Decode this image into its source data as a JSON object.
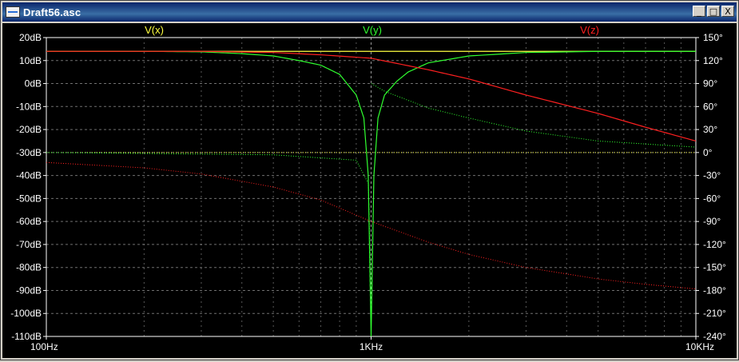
{
  "window": {
    "title": "Draft56.asc",
    "controls": {
      "minimize": "_",
      "maximize": "□",
      "close": "X"
    }
  },
  "colors": {
    "background": "#000000",
    "axis_text": "#ffffff",
    "grid": "#a0a0a0",
    "vx": "#ffff40",
    "vy": "#30ff30",
    "vz": "#ff2020"
  },
  "chart_data": {
    "type": "line",
    "x_scale": "log",
    "xlim": [
      100,
      10000
    ],
    "ylim_left_db": [
      -110,
      20
    ],
    "ylim_right_deg": [
      -240,
      150
    ],
    "grid": true,
    "x_ticks": [
      {
        "value": 100,
        "label": "100Hz"
      },
      {
        "value": 1000,
        "label": "1KHz"
      },
      {
        "value": 10000,
        "label": "10KHz"
      }
    ],
    "y_ticks_left": [
      {
        "value": 20,
        "label": "20dB"
      },
      {
        "value": 10,
        "label": "10dB"
      },
      {
        "value": 0,
        "label": "0dB"
      },
      {
        "value": -10,
        "label": "-10dB"
      },
      {
        "value": -20,
        "label": "-20dB"
      },
      {
        "value": -30,
        "label": "-30dB"
      },
      {
        "value": -40,
        "label": "-40dB"
      },
      {
        "value": -50,
        "label": "-50dB"
      },
      {
        "value": -60,
        "label": "-60dB"
      },
      {
        "value": -70,
        "label": "-70dB"
      },
      {
        "value": -80,
        "label": "-80dB"
      },
      {
        "value": -90,
        "label": "-90dB"
      },
      {
        "value": -100,
        "label": "-100dB"
      },
      {
        "value": -110,
        "label": "-110dB"
      }
    ],
    "y_ticks_right": [
      {
        "value": 150,
        "label": "150°"
      },
      {
        "value": 120,
        "label": "120°"
      },
      {
        "value": 90,
        "label": "90°"
      },
      {
        "value": 60,
        "label": "60°"
      },
      {
        "value": 30,
        "label": "30°"
      },
      {
        "value": 0,
        "label": "0°"
      },
      {
        "value": -30,
        "label": "-30°"
      },
      {
        "value": -60,
        "label": "-60°"
      },
      {
        "value": -90,
        "label": "-90°"
      },
      {
        "value": -120,
        "label": "-120°"
      },
      {
        "value": -150,
        "label": "-150°"
      },
      {
        "value": -180,
        "label": "-180°"
      },
      {
        "value": -210,
        "label": "-210°"
      },
      {
        "value": -240,
        "label": "-240°"
      }
    ],
    "series": [
      {
        "name": "V(x)",
        "color": "#ffff40",
        "legend_pos": "left",
        "magnitude_db": [
          [
            100,
            14
          ],
          [
            300,
            14
          ],
          [
            1000,
            14
          ],
          [
            3000,
            14
          ],
          [
            10000,
            14
          ]
        ],
        "phase_deg": [
          [
            100,
            0
          ],
          [
            1000,
            0
          ],
          [
            10000,
            0
          ]
        ]
      },
      {
        "name": "V(y)",
        "color": "#30ff30",
        "legend_pos": "center",
        "magnitude_db": [
          [
            100,
            14
          ],
          [
            200,
            14
          ],
          [
            300,
            13.8
          ],
          [
            400,
            13
          ],
          [
            500,
            12
          ],
          [
            600,
            10
          ],
          [
            700,
            8
          ],
          [
            800,
            4
          ],
          [
            900,
            -5
          ],
          [
            950,
            -15
          ],
          [
            980,
            -40
          ],
          [
            1000,
            -110
          ],
          [
            1020,
            -40
          ],
          [
            1050,
            -15
          ],
          [
            1100,
            -5
          ],
          [
            1200,
            1
          ],
          [
            1300,
            5
          ],
          [
            1500,
            9
          ],
          [
            2000,
            12
          ],
          [
            3000,
            13.5
          ],
          [
            5000,
            14
          ],
          [
            10000,
            14
          ]
        ],
        "phase_deg": [
          [
            100,
            0
          ],
          [
            500,
            -3
          ],
          [
            900,
            -10
          ],
          [
            980,
            -40
          ],
          [
            1000,
            -180
          ],
          [
            1002,
            90
          ],
          [
            1100,
            80
          ],
          [
            1500,
            58
          ],
          [
            2000,
            45
          ],
          [
            3000,
            28
          ],
          [
            5000,
            15
          ],
          [
            10000,
            7
          ]
        ]
      },
      {
        "name": "V(z)",
        "color": "#ff2020",
        "legend_pos": "right",
        "magnitude_db": [
          [
            100,
            14
          ],
          [
            300,
            14
          ],
          [
            500,
            13.5
          ],
          [
            700,
            12.5
          ],
          [
            1000,
            11
          ],
          [
            1500,
            6
          ],
          [
            2000,
            2
          ],
          [
            3000,
            -5
          ],
          [
            5000,
            -13
          ],
          [
            7000,
            -19
          ],
          [
            10000,
            -25
          ]
        ],
        "phase_deg": [
          [
            100,
            -13
          ],
          [
            200,
            -20
          ],
          [
            300,
            -28
          ],
          [
            500,
            -45
          ],
          [
            700,
            -62
          ],
          [
            1000,
            -90
          ],
          [
            1500,
            -117
          ],
          [
            2000,
            -133
          ],
          [
            3000,
            -150
          ],
          [
            5000,
            -165
          ],
          [
            7000,
            -172
          ],
          [
            10000,
            -178
          ]
        ]
      }
    ]
  }
}
